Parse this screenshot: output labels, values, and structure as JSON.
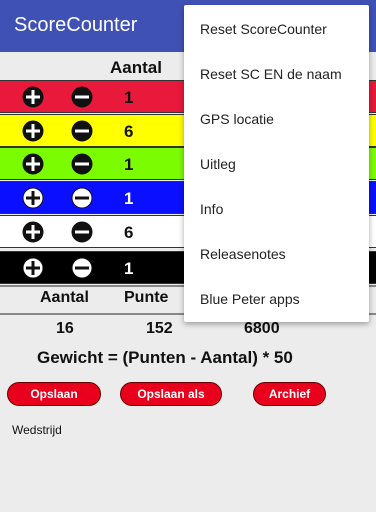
{
  "appbar": {
    "title": "ScoreCounter"
  },
  "table": {
    "header": "Aantal",
    "rows": [
      {
        "color": "#e8193b",
        "value": "1",
        "text_color": "#111",
        "icon_style": "dark"
      },
      {
        "color": "#ffff00",
        "value": "6",
        "text_color": "#111",
        "icon_style": "dark"
      },
      {
        "color": "#7cfc00",
        "value": "1",
        "text_color": "#111",
        "icon_style": "dark"
      },
      {
        "color": "#0a10ff",
        "value": "1",
        "text_color": "#fff",
        "icon_style": "light"
      },
      {
        "color": "#ffffff",
        "value": "6",
        "text_color": "#111",
        "icon_style": "dark"
      },
      {
        "color": "#000000",
        "value": "1",
        "text_color": "#fff",
        "icon_style": "light"
      }
    ]
  },
  "totals": {
    "aantal_label": "Aantal",
    "punten_label": "Punte",
    "aantal_value": "16",
    "punten_value": "152",
    "score_value": "6800"
  },
  "formula": "Gewicht = (Punten - Aantal) * 50",
  "buttons": {
    "save": "Opslaan",
    "save_as": "Opslaan als",
    "archive": "Archief"
  },
  "footer": {
    "mode": "Wedstrijd"
  },
  "menu": {
    "items": [
      "Reset ScoreCounter",
      "Reset SC EN de naam",
      "GPS locatie",
      "Uitleg",
      "Info",
      "Releasenotes",
      "Blue Peter apps"
    ]
  }
}
